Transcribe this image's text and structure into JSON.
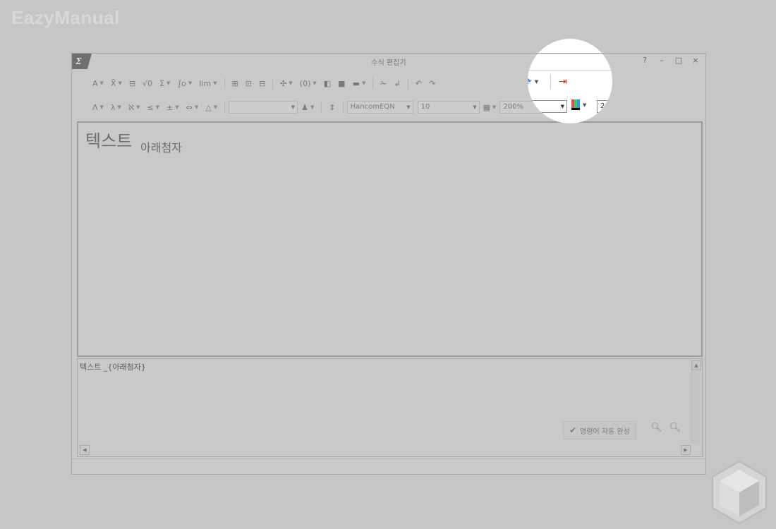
{
  "watermark": "EazyManual",
  "window": {
    "title": "수식 편집기",
    "app_icon_glyph": "Σ",
    "title_buttons": {
      "help": "?",
      "minimize": "–",
      "maximize": "□",
      "close": "×"
    }
  },
  "toolbar": {
    "row1": [
      {
        "name": "font-style-button",
        "glyph": "A",
        "dropdown": true
      },
      {
        "name": "accent-button",
        "glyph": "X̄",
        "dropdown": true
      },
      {
        "name": "fraction-button",
        "glyph": "⊟",
        "dropdown": false
      },
      {
        "name": "root-button",
        "glyph": "√0",
        "dropdown": false
      },
      {
        "name": "sum-button",
        "glyph": "Σ",
        "dropdown": true
      },
      {
        "name": "integral-button",
        "glyph": "∫o",
        "dropdown": true
      },
      {
        "name": "limit-button",
        "glyph": "lim",
        "dropdown": true
      },
      {
        "name": "matrix-button-1",
        "glyph": "⊞",
        "dropdown": false
      },
      {
        "name": "matrix-button-2",
        "glyph": "⊡",
        "dropdown": false
      },
      {
        "name": "matrix-button-3",
        "glyph": "⊟",
        "dropdown": false
      },
      {
        "name": "bracket-button",
        "glyph": "✣",
        "dropdown": true
      },
      {
        "name": "paren-button",
        "glyph": "(0)",
        "dropdown": true
      },
      {
        "name": "box-button-1",
        "glyph": "◧",
        "dropdown": false
      },
      {
        "name": "box-button-2",
        "glyph": "■",
        "dropdown": false
      },
      {
        "name": "box-button-3",
        "glyph": "▬",
        "dropdown": true
      },
      {
        "name": "cut-button",
        "glyph": "✁",
        "dropdown": false
      },
      {
        "name": "paste-button",
        "glyph": "↲",
        "dropdown": false
      },
      {
        "name": "undo-button",
        "glyph": "↶",
        "dropdown": false
      },
      {
        "name": "redo-button",
        "glyph": "↷",
        "dropdown": false
      }
    ],
    "row2": [
      {
        "name": "greek-upper-button",
        "glyph": "Λ",
        "dropdown": true
      },
      {
        "name": "greek-lower-button",
        "glyph": "λ",
        "dropdown": true
      },
      {
        "name": "symbol-button",
        "glyph": "ℵ",
        "dropdown": true
      },
      {
        "name": "relation-button",
        "glyph": "≤",
        "dropdown": true
      },
      {
        "name": "operator-button",
        "glyph": "±",
        "dropdown": true
      },
      {
        "name": "arrow-button",
        "glyph": "⇔",
        "dropdown": true
      },
      {
        "name": "misc-button",
        "glyph": "△",
        "dropdown": true
      }
    ],
    "font_combo": "HancomEQN",
    "size_combo": "10",
    "zoom_combo": "200%"
  },
  "highlight": {
    "redraw_glyph": "⟳",
    "insert_glyph": "⇥",
    "size_value": "10",
    "zoom_value": "200%"
  },
  "editor": {
    "main_text": "텍스트",
    "sub_text": "아래첨자"
  },
  "script": {
    "text": "텍스트 _{아래첨자}",
    "autocomplete_label": "명령어 자동 완성",
    "autocomplete_checked": true
  }
}
